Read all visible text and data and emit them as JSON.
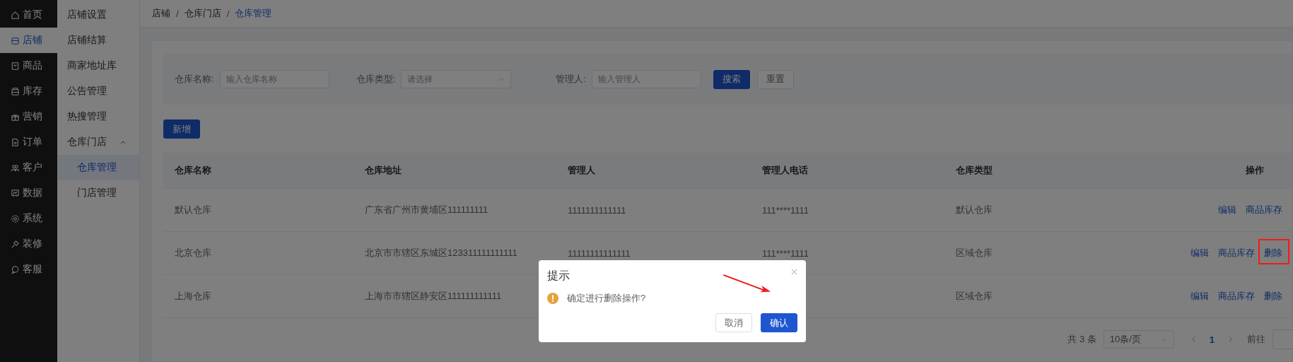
{
  "main_nav": [
    {
      "label": "首页",
      "selected": false
    },
    {
      "label": "店铺",
      "selected": true
    },
    {
      "label": "商品",
      "selected": false
    },
    {
      "label": "库存",
      "selected": false
    },
    {
      "label": "营销",
      "selected": false
    },
    {
      "label": "订单",
      "selected": false
    },
    {
      "label": "客户",
      "selected": false
    },
    {
      "label": "数据",
      "selected": false
    },
    {
      "label": "系统",
      "selected": false
    },
    {
      "label": "装修",
      "selected": false
    },
    {
      "label": "客服",
      "selected": false
    }
  ],
  "sub_nav": [
    {
      "label": "店铺设置",
      "selected": false
    },
    {
      "label": "店铺结算",
      "selected": false
    },
    {
      "label": "商家地址库",
      "selected": false
    },
    {
      "label": "公告管理",
      "selected": false
    },
    {
      "label": "热搜管理",
      "selected": false
    },
    {
      "label": "仓库门店",
      "expanded": true,
      "children": [
        {
          "label": "仓库管理",
          "selected": true
        },
        {
          "label": "门店管理",
          "selected": false
        }
      ]
    }
  ],
  "breadcrumb": [
    "店铺",
    "仓库门店",
    "仓库管理"
  ],
  "breadcrumb_separator": "/",
  "filters": [
    {
      "kind": "input",
      "label": "仓库名称:",
      "placeholder": "输入仓库名称"
    },
    {
      "kind": "select",
      "label": "仓库类型:",
      "placeholder": "请选择"
    },
    {
      "kind": "input",
      "label": "管理人:",
      "placeholder": "输入管理人"
    }
  ],
  "search_button": "搜索",
  "reset_button": "重置",
  "add_button": "新增",
  "table": {
    "columns": [
      "仓库名称",
      "仓库地址",
      "管理人",
      "管理人电话",
      "仓库类型",
      "操作"
    ],
    "rows": [
      {
        "cells": [
          "默认仓库",
          "广东省广州市黄埔区111111111",
          "1111111111111",
          "111****1111",
          "默认仓库"
        ],
        "actions": [
          "编辑",
          "商品库存"
        ]
      },
      {
        "cells": [
          "北京仓库",
          "北京市市辖区东城区123311111111111",
          "11111111111111",
          "111****1111",
          "区域仓库"
        ],
        "actions": [
          "编辑",
          "商品库存",
          "删除"
        ]
      },
      {
        "cells": [
          "上海仓库",
          "上海市市辖区静安区111111111111",
          null,
          null,
          "区域仓库"
        ],
        "actions": [
          "编辑",
          "商品库存",
          "删除"
        ]
      }
    ]
  },
  "pagination": {
    "total": "共 3 条",
    "page_size": "10条/页",
    "pages": [
      {
        "label": "1",
        "selected": true
      }
    ],
    "goto_label": "前往"
  },
  "dialog": {
    "title": "提示",
    "message": "确定进行删除操作?",
    "cancel": "取消",
    "confirm": "确认"
  }
}
